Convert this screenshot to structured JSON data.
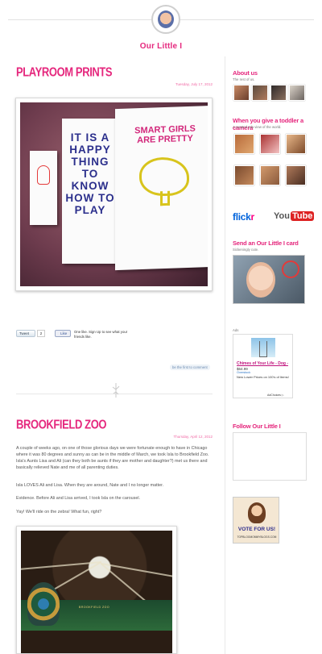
{
  "site": {
    "title": "Our Little I"
  },
  "posts": [
    {
      "title": "PLAYROOM PRINTS",
      "date": "Tuesday, July 17, 2012",
      "image_alt": "Three framed prints on a wall",
      "prints_text": {
        "middle": "IT IS A HAPPY THING TO KNOW HOW TO PLAY",
        "right": "SMART GIRLS ARE PRETTY"
      },
      "tweet_label": "Tweet",
      "tweet_count": "2",
      "like_label": "Like",
      "like_text": "One like. Sign Up to see what your friends like.",
      "comment_link": "be the first to comment"
    },
    {
      "title": "BROOKFIELD ZOO",
      "date": "Thursday, April 12, 2012",
      "paragraphs": [
        "A couple of weeks ago, on one of those glorious days we were fortunate enough to have in Chicago where it was 80 degrees and sunny as can be in the middle of March, we took Isla to Brookfield Zoo.  Isla's Aunts Lisa and Ali (can they both be aunts if they are mother and daughter?) met us there and basically relieved Nate and me of all parenting duties.",
        "Isla LOVES Ali and Lisa.  When they are around, Nate and I no longer matter.",
        "Evidence.  Before Ali and Lisa arrived, I took Isla on the carousel.",
        "Yay! We'll ride on the zebra!  What fun, right?"
      ],
      "carousel_label": "BROOKFIELD ZOO"
    }
  ],
  "sidebar": {
    "about": {
      "title": "About us",
      "subtitle": "The rest of us."
    },
    "camera": {
      "title": "When you give a toddler a camera",
      "subtitle": "A curated Isla view of the world."
    },
    "flickr": {
      "left": "flick",
      "right": "r"
    },
    "youtube": {
      "left": "You",
      "right": "Tube"
    },
    "card": {
      "title": "Send an Our Little I card",
      "subtitle": "Sickeningly cute."
    },
    "ads": {
      "label": "Ads",
      "title": "Chimes of Your Life - Dog -",
      "price": "$64.99",
      "brand": "Overstock",
      "desc": "New Lower Prices on 100's of Items!",
      "choices": "AdChoices ▷"
    },
    "follow": {
      "title": "Follow Our Little I"
    },
    "vote": {
      "label": "VOTE FOR US!",
      "url": "TOPBLOGMOMMYBLOGS.COM"
    }
  },
  "colors": {
    "accent": "#e5277d",
    "date": "#f06aa5",
    "text": "#555555"
  },
  "icons": [
    "avatar",
    "tweet-icon",
    "like-icon",
    "flickr-logo",
    "youtube-logo",
    "adchoices-icon"
  ]
}
